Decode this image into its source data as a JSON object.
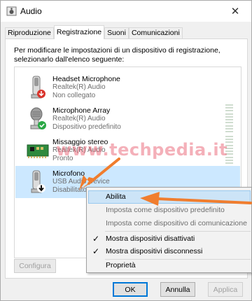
{
  "window": {
    "title": "Audio",
    "close_glyph": "✕"
  },
  "tabs": [
    {
      "label": "Riproduzione",
      "active": false
    },
    {
      "label": "Registrazione",
      "active": true
    },
    {
      "label": "Suoni",
      "active": false
    },
    {
      "label": "Comunicazioni",
      "active": false
    }
  ],
  "instruction": "Per modificare le impostazioni di un dispositivo di registrazione, selezionarlo dall'elenco seguente:",
  "devices": [
    {
      "name": "Headset Microphone",
      "driver": "Realtek(R) Audio",
      "status": "Non collegato",
      "icon": "headset-mic-icon",
      "badge": "red-down-arrow",
      "selected": false
    },
    {
      "name": "Microphone Array",
      "driver": "Realtek(R) Audio",
      "status": "Dispositivo predefinito",
      "icon": "microphone-array-icon",
      "badge": "green-check",
      "selected": false
    },
    {
      "name": "Missaggio stereo",
      "driver": "Realtek(R) Audio",
      "status": "Pronto",
      "icon": "sound-card-icon",
      "badge": "none",
      "selected": false
    },
    {
      "name": "Microfono",
      "driver": "USB Audio Device",
      "status": "Disabilitato",
      "icon": "microphone-icon",
      "badge": "black-down-arrow",
      "selected": true
    }
  ],
  "configure_label": "Configura",
  "context_menu": {
    "items": [
      {
        "label": "Abilita",
        "checked": false,
        "disabled": false,
        "hover": true
      },
      {
        "label": "Imposta come dispositivo predefinito",
        "checked": false,
        "disabled": true,
        "hover": false
      },
      {
        "label": "Imposta come dispositivo di comunicazione",
        "checked": false,
        "disabled": true,
        "hover": false
      },
      {
        "label": "Mostra dispositivi disattivati",
        "checked": true,
        "disabled": false,
        "hover": false
      },
      {
        "label": "Mostra dispositivi disconnessi",
        "checked": true,
        "disabled": false,
        "hover": false
      },
      {
        "label": "Proprietà",
        "checked": false,
        "disabled": false,
        "hover": false
      }
    ],
    "check_glyph": "✓"
  },
  "buttons": {
    "ok": "OK",
    "cancel": "Annulla",
    "apply": "Applica"
  },
  "watermark": "www.techpedia.it",
  "colors": {
    "selection": "#cce8ff",
    "menu_hover": "#cce4f7",
    "arrow": "#f07d2e",
    "check_green": "#2aa845",
    "badge_red": "#d9342b"
  }
}
